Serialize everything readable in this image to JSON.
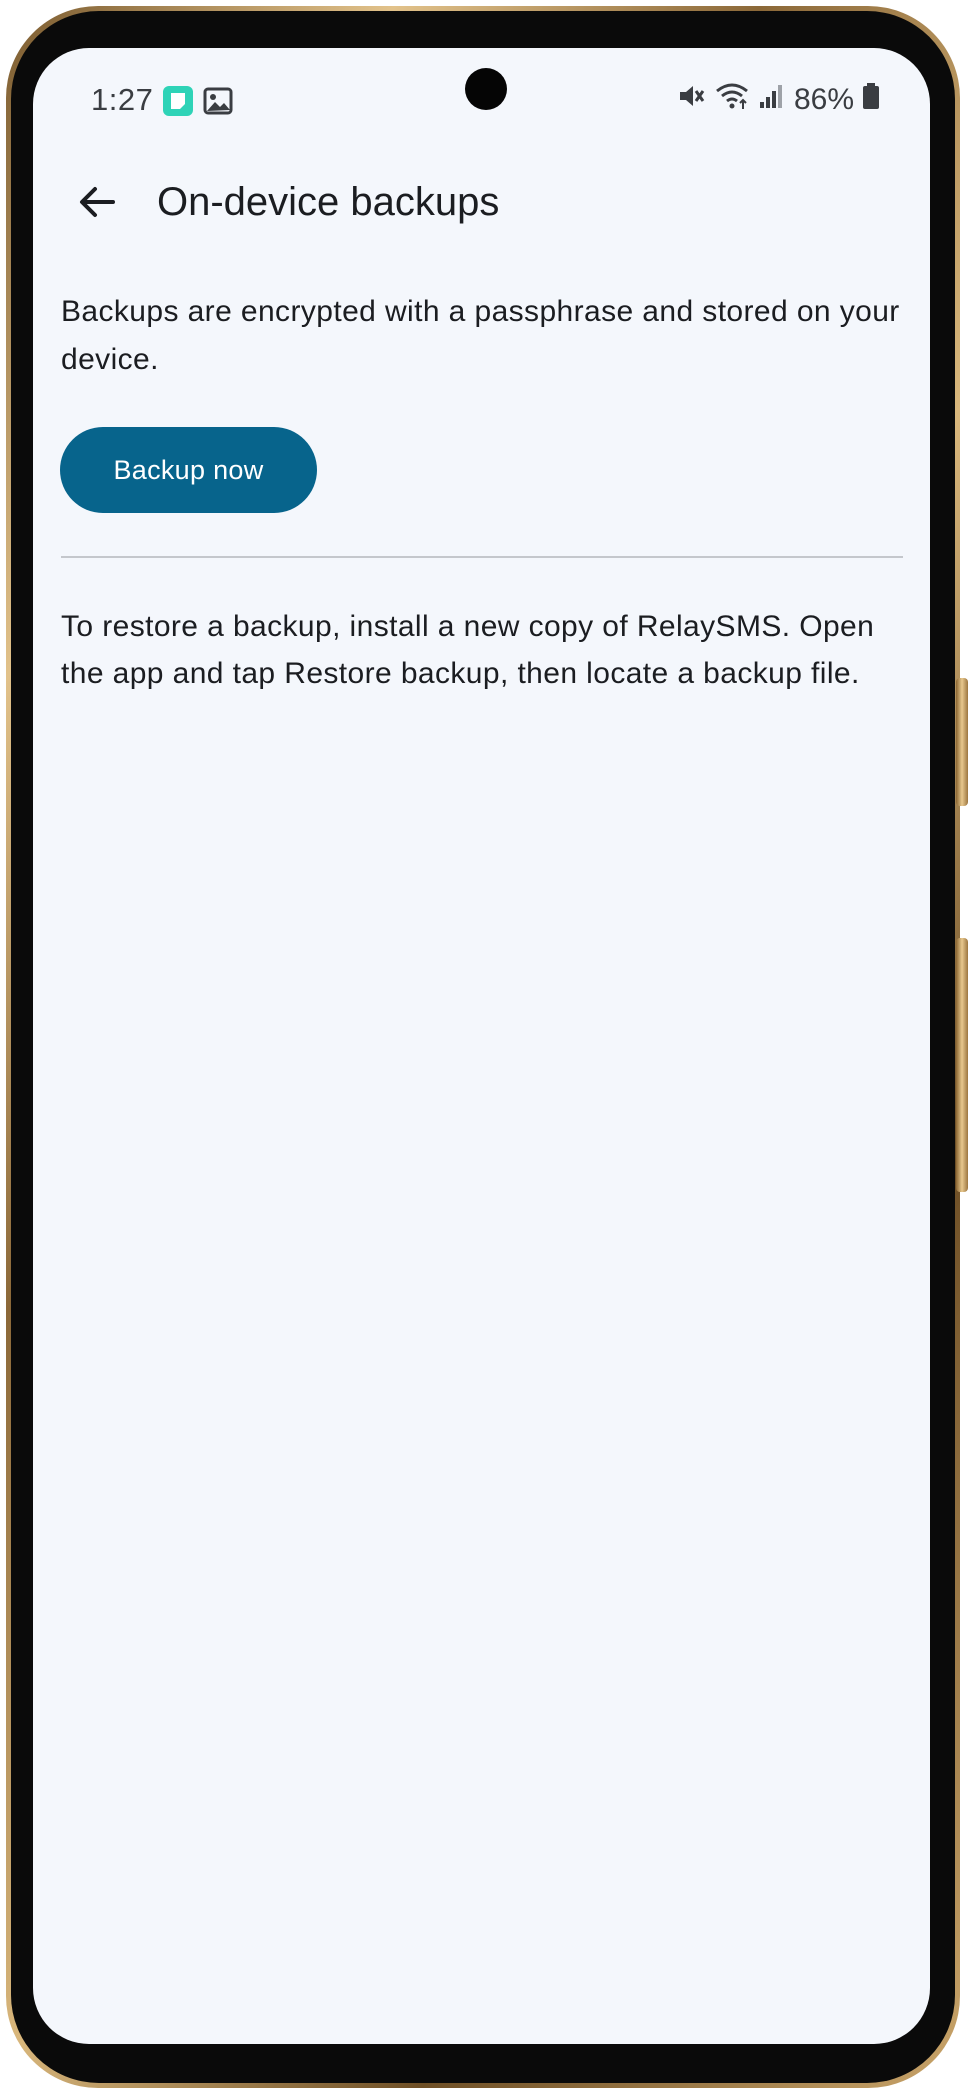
{
  "status_bar": {
    "time": "1:27",
    "battery_percent": "86%",
    "notification_icons": [
      "app-notification-icon",
      "image-icon"
    ],
    "system_icons": [
      "mute-icon",
      "wifi-icon",
      "signal-icon",
      "battery-icon"
    ]
  },
  "header": {
    "title": "On-device backups",
    "back_icon": "arrow-back-icon"
  },
  "content": {
    "description": "Backups are encrypted with a passphrase and stored on your device.",
    "backup_button_label": "Backup now",
    "restore_instructions": "To restore a backup, install a new copy of RelaySMS. Open the app and tap Restore backup, then locate a backup file."
  },
  "colors": {
    "primary": "#07648c",
    "background": "#f4f7fc",
    "text": "#1b1d21",
    "divider": "#c4c7cc",
    "notification_accent": "#2ed3b7"
  }
}
